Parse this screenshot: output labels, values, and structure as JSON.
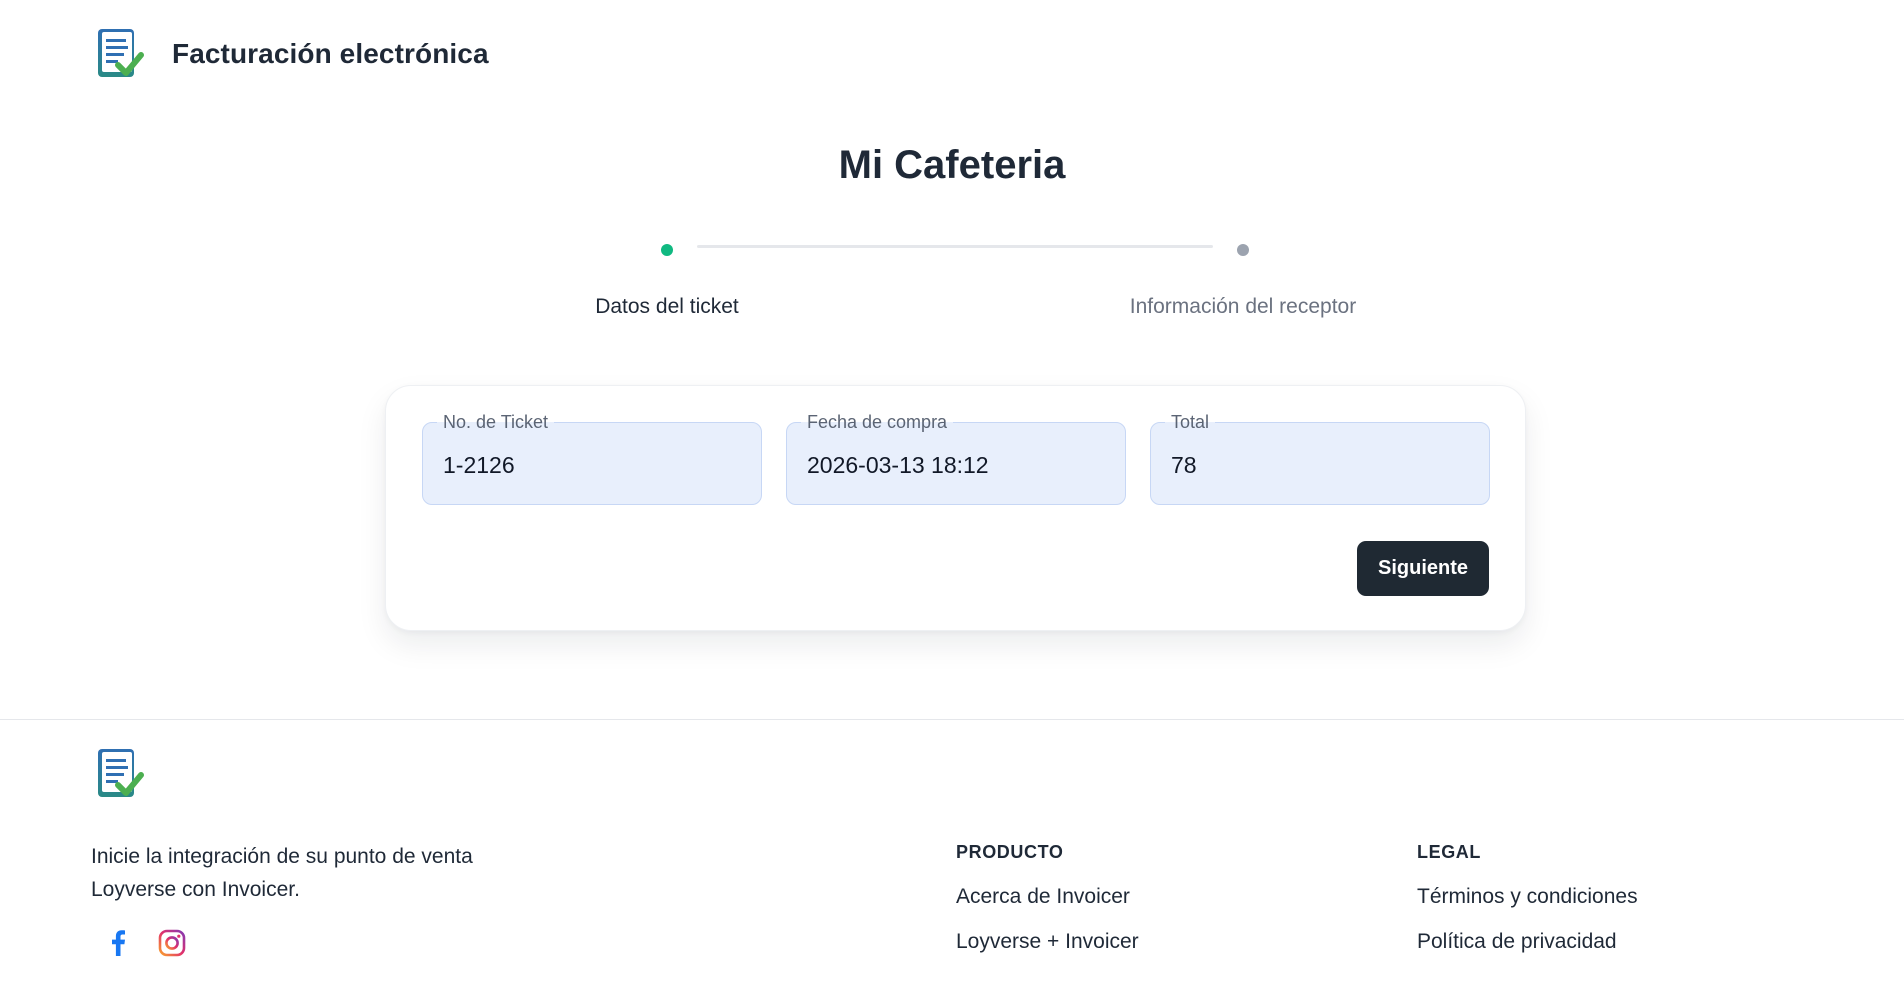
{
  "header": {
    "brand": "Facturación electrónica",
    "logo_icon": "invoice-check-icon"
  },
  "page": {
    "title": "Mi Cafeteria"
  },
  "stepper": {
    "steps": [
      {
        "label": "Datos del ticket",
        "state": "active",
        "color": "#10b981"
      },
      {
        "label": "Información del receptor",
        "state": "inactive",
        "color": "#9ca3af"
      }
    ]
  },
  "form": {
    "fields": [
      {
        "label": "No. de Ticket",
        "value": "1-2126"
      },
      {
        "label": "Fecha de compra",
        "value": "2026-03-13 18:12"
      },
      {
        "label": "Total",
        "value": "78"
      }
    ],
    "next_label": "Siguiente"
  },
  "footer": {
    "logo_icon": "invoice-check-icon",
    "description": "Inicie la integración de su punto de venta Loyverse con Invoicer.",
    "social": [
      {
        "name": "facebook-icon",
        "color": "#1877f2"
      },
      {
        "name": "instagram-icon",
        "color": "#e1306c"
      }
    ],
    "product": {
      "heading": "PRODUCTO",
      "links": [
        "Acerca de Invoicer",
        "Loyverse + Invoicer"
      ]
    },
    "legal": {
      "heading": "LEGAL",
      "links": [
        "Términos y condiciones",
        "Política de privacidad"
      ]
    }
  },
  "colors": {
    "accent_dark": "#1f2933",
    "field_bg": "#e8effc",
    "step_active": "#10b981",
    "step_inactive": "#9ca3af"
  }
}
